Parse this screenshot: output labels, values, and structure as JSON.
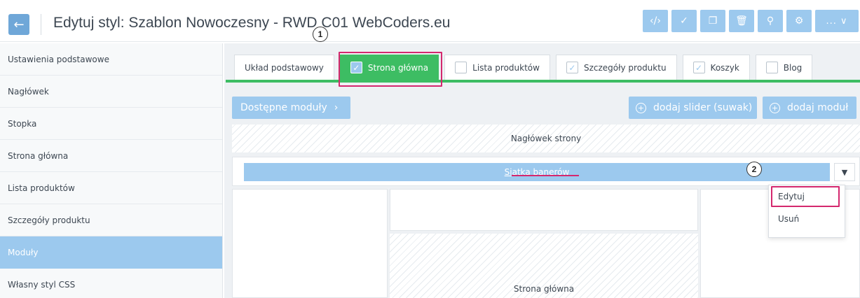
{
  "header": {
    "title": "Edytuj styl: Szablon Nowoczesny - RWD C01 WebCoders.eu",
    "back_icon": "arrow-left-icon",
    "toolbar": [
      {
        "name": "code",
        "icon": "code-icon",
        "glyph": "‹/›"
      },
      {
        "name": "check",
        "icon": "check-circle-icon",
        "glyph": "✓"
      },
      {
        "name": "copy",
        "icon": "copy-icon",
        "glyph": "❐"
      },
      {
        "name": "trash",
        "icon": "trash-icon",
        "glyph": "🗑"
      },
      {
        "name": "search",
        "icon": "search-icon",
        "glyph": "⚲"
      },
      {
        "name": "settings",
        "icon": "gear-icon",
        "glyph": "⚙"
      }
    ],
    "more_label": "... ∨"
  },
  "markers": {
    "one": "1",
    "two": "2"
  },
  "sidebar": {
    "items": [
      {
        "label": "Ustawienia podstawowe",
        "active": false
      },
      {
        "label": "Nagłówek",
        "active": false
      },
      {
        "label": "Stopka",
        "active": false
      },
      {
        "label": "Strona główna",
        "active": false
      },
      {
        "label": "Lista produktów",
        "active": false
      },
      {
        "label": "Szczegóły produktu",
        "active": false
      },
      {
        "label": "Moduły",
        "active": true
      },
      {
        "label": "Własny styl CSS",
        "active": false
      }
    ]
  },
  "tabs": [
    {
      "label": "Układ podstawowy",
      "checkbox": false,
      "checked": false,
      "active": false
    },
    {
      "label": "Strona główna",
      "checkbox": true,
      "checked": true,
      "active": true
    },
    {
      "label": "Lista produktów",
      "checkbox": true,
      "checked": false,
      "active": false
    },
    {
      "label": "Szczegóły produktu",
      "checkbox": true,
      "checked": true,
      "active": false
    },
    {
      "label": "Koszyk",
      "checkbox": true,
      "checked": true,
      "active": false
    },
    {
      "label": "Blog",
      "checkbox": true,
      "checked": false,
      "active": false
    }
  ],
  "buttons": {
    "available_modules": "Dostępne moduły",
    "add_slider": "dodaj slider (suwak)",
    "add_module": "dodaj moduł"
  },
  "layout_blocks": {
    "page_header": "Nagłówek strony",
    "banner_grid": "Siatka banerów",
    "main_page": "Strona główna"
  },
  "dropdown": {
    "items": [
      "Edytuj",
      "Usuń"
    ]
  },
  "colors": {
    "accent_blue": "#9cc9ee",
    "active_green": "#3dbd63",
    "highlight_pink": "#d4286e"
  }
}
